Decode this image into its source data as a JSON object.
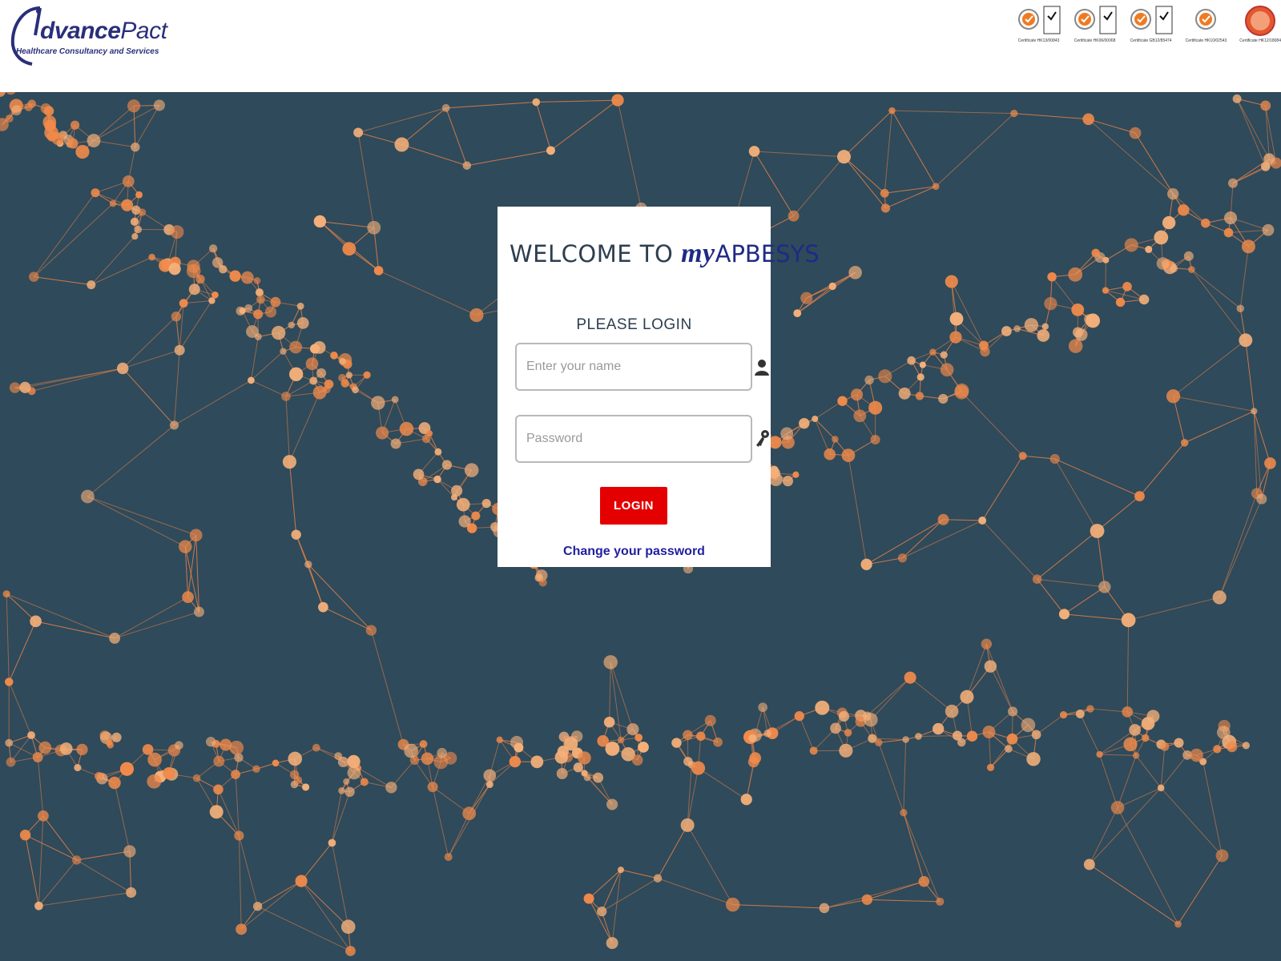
{
  "header": {
    "logo_name_bold": "dvance",
    "logo_name_light": "Pact",
    "logo_tagline": "Healthcare Consultancy and Services",
    "certifications": [
      {
        "name": "SGS UKAS",
        "text": "Certificate HK13/00843"
      },
      {
        "name": "SGS UKAS",
        "text": "Certificate HK06/00068"
      },
      {
        "name": "SGS UKAS",
        "text": "Certificate GB12/85474"
      },
      {
        "name": "SGS",
        "text": "Certificate HK10/02543"
      },
      {
        "name": "STANDARDS",
        "text": "Certificate HK12/18084"
      }
    ]
  },
  "login": {
    "welcome_prefix": "WELCOME TO",
    "welcome_my": "my",
    "welcome_brand": "APBESYS",
    "subtitle": "PLEASE LOGIN",
    "name_placeholder": "Enter your name",
    "name_value": "",
    "password_placeholder": "Password",
    "password_value": "",
    "login_label": "LOGIN",
    "change_password_label": "Change your password"
  },
  "colors": {
    "background": "#2f4a5a",
    "accent_orange": "#e8834a",
    "login_red": "#e40000",
    "brand_blue": "#1f2a85",
    "link_blue": "#1f1fa0"
  },
  "icons": [
    "user-icon",
    "key-icon"
  ]
}
